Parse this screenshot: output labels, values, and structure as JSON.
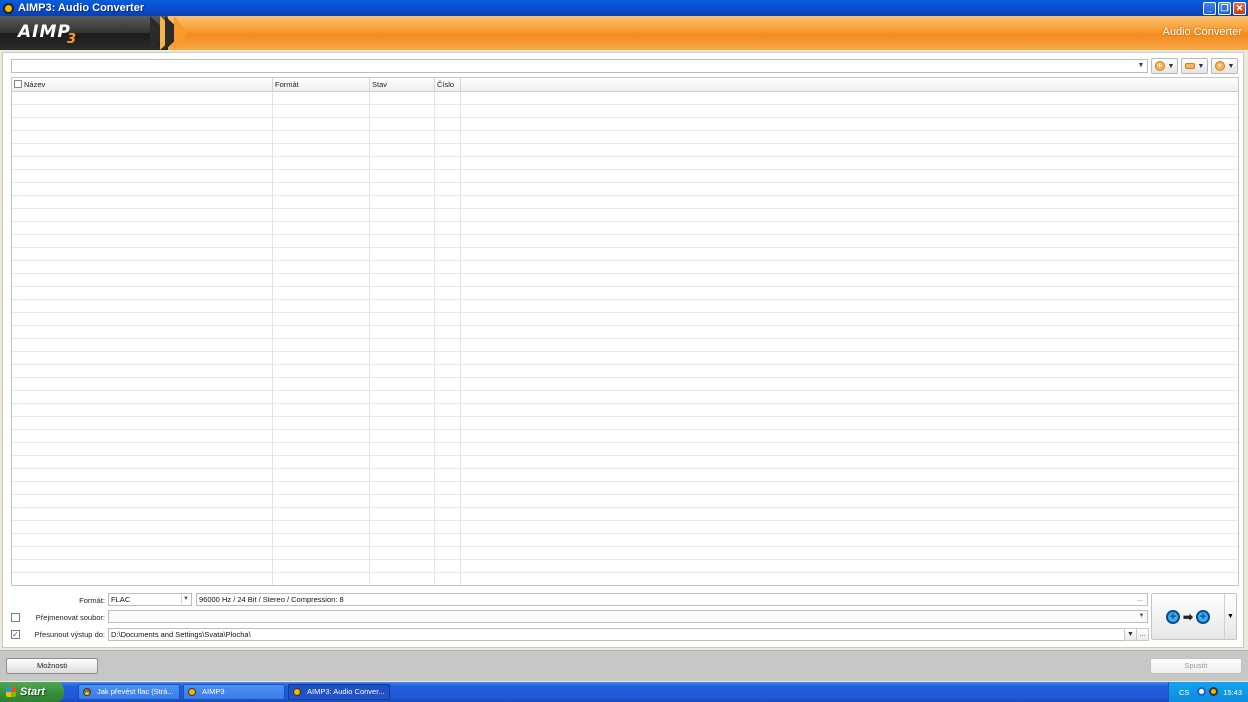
{
  "window": {
    "title": "AIMP3: Audio Converter"
  },
  "banner": {
    "logo": "AIMP",
    "logo_sub": "3",
    "heading": "Audio Converter"
  },
  "table": {
    "columns": [
      {
        "label": "Název"
      },
      {
        "label": "Formát"
      },
      {
        "label": "Stav"
      },
      {
        "label": "Číslo"
      }
    ],
    "rows": []
  },
  "settings": {
    "format_label": "Formát:",
    "format_value": "FLAC",
    "format_details": "96000 Hz / 24 Bit / Stereo / Compression: 8",
    "rename_label": "Přejmenovat soubor:",
    "rename_checked": false,
    "rename_value": "",
    "move_label": "Přesunout výstup do:",
    "move_checked": true,
    "move_value": "D:\\Documents and Settings\\Svata\\Plocha\\",
    "browse_label": "..."
  },
  "footer": {
    "options_label": "Možnosti",
    "start_label": "Spustit"
  },
  "taskbar": {
    "start_label": "Start",
    "tasks": [
      {
        "label": "Jak převést flac (Strá..."
      },
      {
        "label": "AIMP3"
      },
      {
        "label": "AIMP3: Audio Conver..."
      }
    ],
    "lang": "CS",
    "clock": "15:43"
  },
  "colors": {
    "accent": "#f89a2c",
    "titlebar": "#0553d8",
    "taskbar": "#245edb"
  }
}
